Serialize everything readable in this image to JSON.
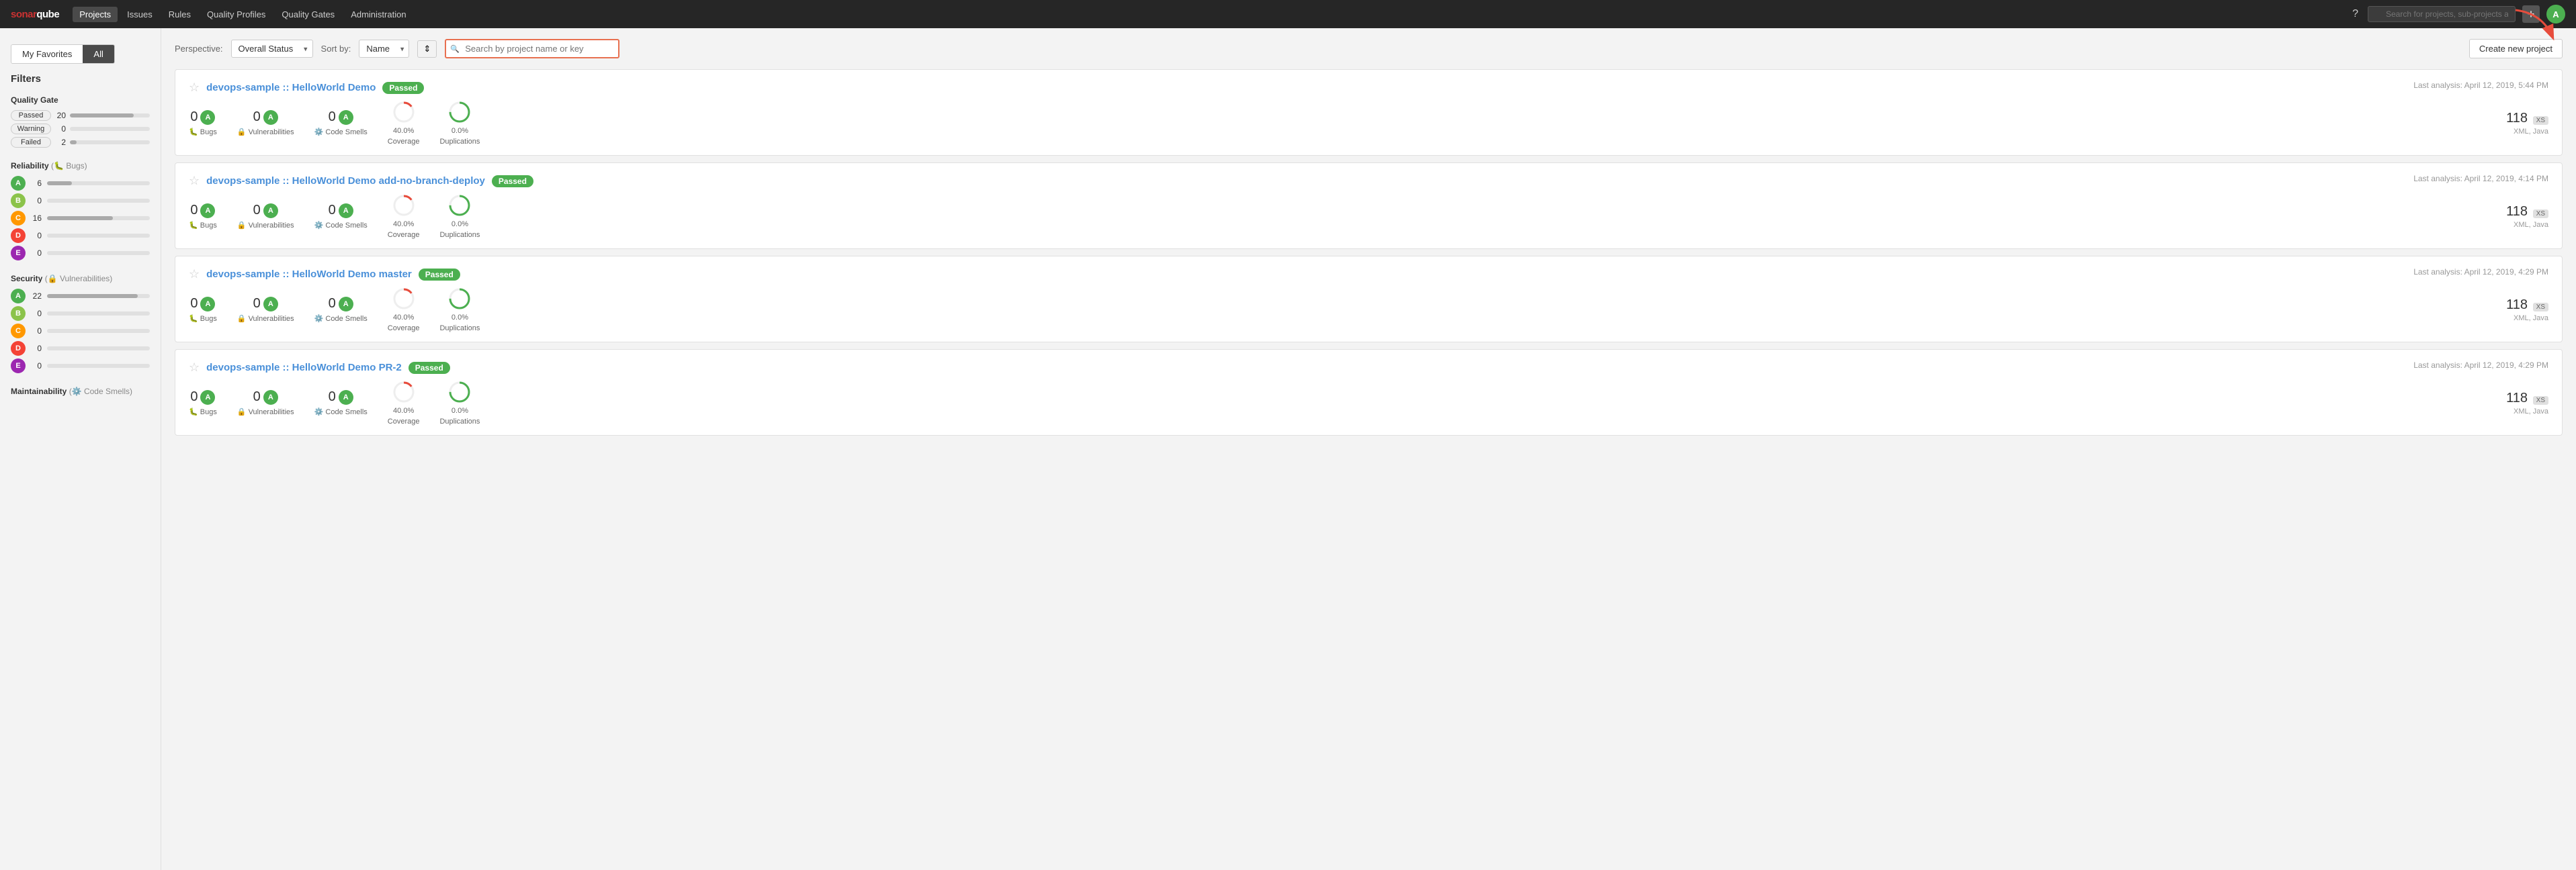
{
  "app": {
    "title": "SonarQube",
    "logo_brand": "sonar",
    "logo_suffix": "qube"
  },
  "topnav": {
    "links": [
      "Projects",
      "Issues",
      "Rules",
      "Quality Profiles",
      "Quality Gates",
      "Administration"
    ],
    "active_link": "Projects",
    "search_placeholder": "Search for projects, sub-projects and files...",
    "avatar_letter": "A"
  },
  "tabs": {
    "my_favorites": "My Favorites",
    "all": "All",
    "active": "All"
  },
  "filters": {
    "title": "Filters",
    "quality_gate": {
      "title": "Quality Gate",
      "items": [
        {
          "label": "Passed",
          "count": 20,
          "bar_pct": 80
        },
        {
          "label": "Warning",
          "count": 0,
          "bar_pct": 0
        },
        {
          "label": "Failed",
          "count": 2,
          "bar_pct": 8
        }
      ]
    },
    "reliability": {
      "title": "Reliability",
      "subtitle": "Bugs",
      "grades": [
        {
          "grade": "A",
          "count": 6,
          "bar_pct": 24
        },
        {
          "grade": "B",
          "count": 0,
          "bar_pct": 0
        },
        {
          "grade": "C",
          "count": 16,
          "bar_pct": 64
        },
        {
          "grade": "D",
          "count": 0,
          "bar_pct": 0
        },
        {
          "grade": "E",
          "count": 0,
          "bar_pct": 0
        }
      ]
    },
    "security": {
      "title": "Security",
      "subtitle": "Vulnerabilities",
      "grades": [
        {
          "grade": "A",
          "count": 22,
          "bar_pct": 88
        },
        {
          "grade": "B",
          "count": 0,
          "bar_pct": 0
        },
        {
          "grade": "C",
          "count": 0,
          "bar_pct": 0
        },
        {
          "grade": "D",
          "count": 0,
          "bar_pct": 0
        },
        {
          "grade": "E",
          "count": 0,
          "bar_pct": 0
        }
      ]
    },
    "maintainability": {
      "title": "Maintainability",
      "subtitle": "Code Smells"
    }
  },
  "toolbar": {
    "perspective_label": "Perspective:",
    "perspective_value": "Overall Status",
    "sortby_label": "Sort by:",
    "sortby_value": "Name",
    "search_placeholder": "Search by project name or key",
    "create_new_project": "Create new project"
  },
  "projects": [
    {
      "id": 1,
      "name": "devops-sample :: HelloWorld Demo",
      "quality_status": "Passed",
      "last_analysis": "Last analysis: April 12, 2019, 5:44 PM",
      "bugs": 0,
      "vulnerabilities": 0,
      "code_smells": 0,
      "coverage": "40.0%",
      "duplications": "0.0%",
      "lines": 118,
      "size_badge": "XS",
      "technologies": "XML, Java"
    },
    {
      "id": 2,
      "name": "devops-sample :: HelloWorld Demo add-no-branch-deploy",
      "quality_status": "Passed",
      "last_analysis": "Last analysis: April 12, 2019, 4:14 PM",
      "bugs": 0,
      "vulnerabilities": 0,
      "code_smells": 0,
      "coverage": "40.0%",
      "duplications": "0.0%",
      "lines": 118,
      "size_badge": "XS",
      "technologies": "XML, Java"
    },
    {
      "id": 3,
      "name": "devops-sample :: HelloWorld Demo master",
      "quality_status": "Passed",
      "last_analysis": "Last analysis: April 12, 2019, 4:29 PM",
      "bugs": 0,
      "vulnerabilities": 0,
      "code_smells": 0,
      "coverage": "40.0%",
      "duplications": "0.0%",
      "lines": 118,
      "size_badge": "XS",
      "technologies": "XML, Java"
    },
    {
      "id": 4,
      "name": "devops-sample :: HelloWorld Demo PR-2",
      "quality_status": "Passed",
      "last_analysis": "Last analysis: April 12, 2019, 4:29 PM",
      "bugs": 0,
      "vulnerabilities": 0,
      "code_smells": 0,
      "coverage": "40.0%",
      "duplications": "0.0%",
      "lines": 118,
      "size_badge": "XS",
      "technologies": "XML, Java"
    }
  ],
  "colors": {
    "passed_green": "#4caf50",
    "warning_orange": "#ff9800",
    "failed_red": "#f44336",
    "link_blue": "#4a90d9",
    "grade_a": "#4caf50",
    "coverage_ring_red": "#e74c3c",
    "dup_ring_green": "#4caf50"
  }
}
